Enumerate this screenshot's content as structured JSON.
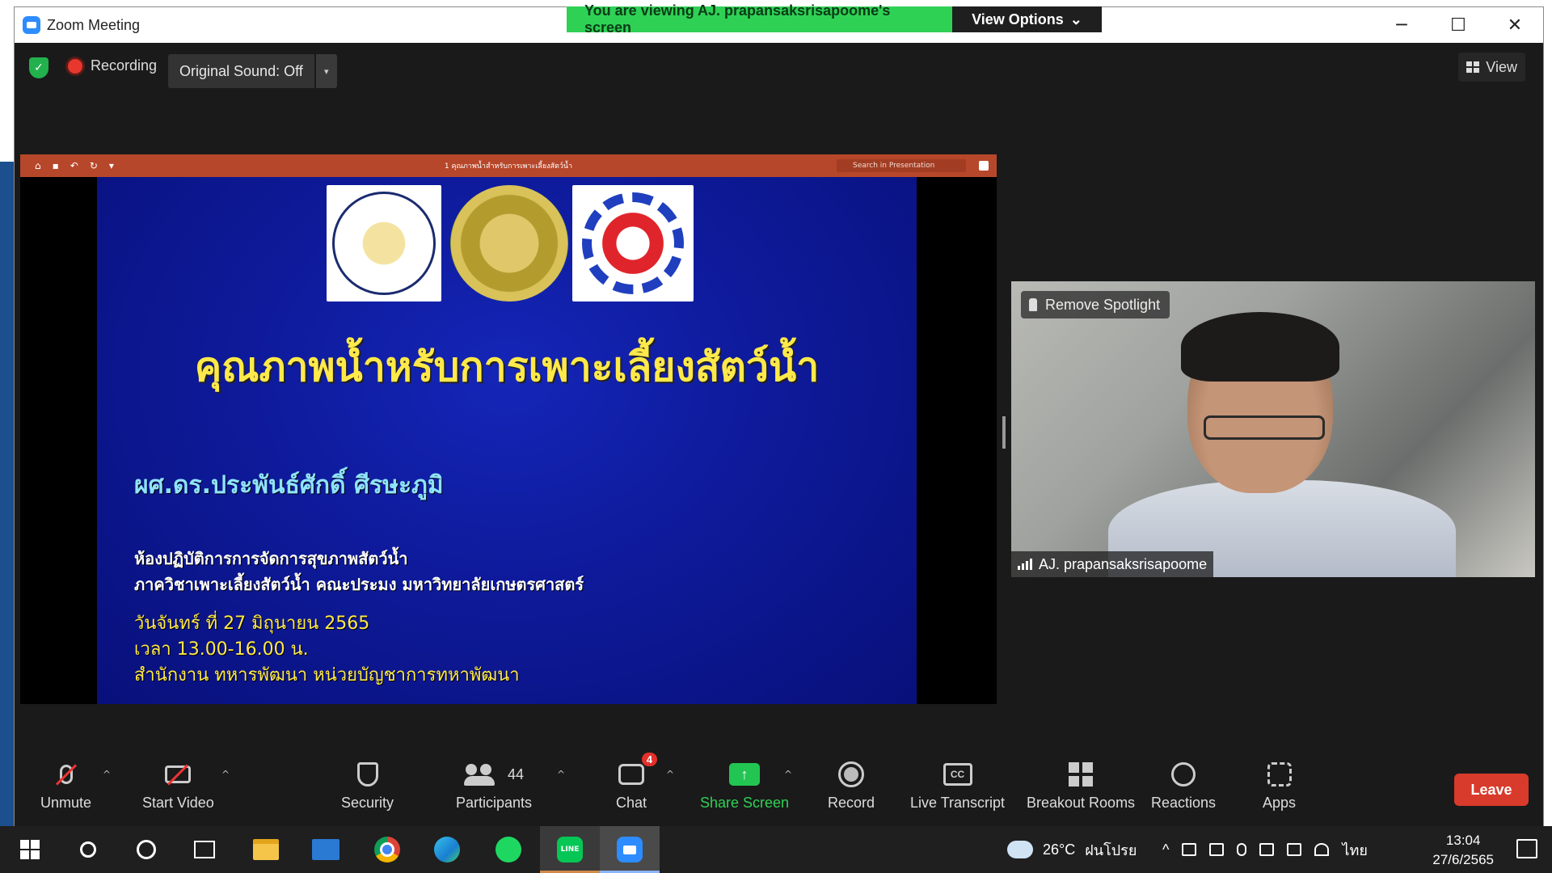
{
  "window": {
    "title": "Zoom Meeting",
    "controls": {
      "minimize": "─",
      "maximize": "☐",
      "close": "✕"
    }
  },
  "banner": {
    "viewing_text": "You are viewing AJ. prapansaksrisapoome's screen",
    "view_options_label": "View Options",
    "view_options_caret": "⌄"
  },
  "topbar": {
    "recording_label": "Recording",
    "original_sound_label": "Original Sound: Off",
    "dropdown_caret": "▾",
    "view_label": "View"
  },
  "shared_app": {
    "document_title": "1 คุณภาพน้ำสำหรับการเพาะเลี้ยงสัตว์น้ำ",
    "search_placeholder": "Search in Presentation",
    "toolbar_icons": [
      "home-icon",
      "save-icon",
      "undo-icon",
      "redo-icon",
      "more-icon"
    ]
  },
  "slide": {
    "title": "คุณภาพน้ำหรับการเพาะเลี้ยงสัตว์น้ำ",
    "author": "ผศ.ดร.ประพันธ์ศักดิ์ ศีรษะภูมิ",
    "lab_line1": "ห้องปฏิบัติการการจัดการสุขภาพสัตว์น้ำ",
    "lab_line2": "ภาควิชาเพาะเลี้ยงสัตว์น้ำ คณะประมง มหาวิทยาลัยเกษตรศาสตร์",
    "date_line": "วันจันทร์ ที่ 27 มิถุนายน 2565",
    "time_line": "เวลา 13.00-16.00 น.",
    "place_line": "สำนักงาน ทหารพัฒนา หน่วยบัญชาการทหาพัฒนา",
    "colors": {
      "title": "#ffe94a",
      "author": "#8fe3ff",
      "background": "#0e1a9a"
    }
  },
  "video": {
    "remove_spotlight_label": "Remove Spotlight",
    "participant_name": "AJ. prapansaksrisapoome"
  },
  "toolbar": {
    "unmute_label": "Unmute",
    "start_video_label": "Start Video",
    "security_label": "Security",
    "participants_label": "Participants",
    "participants_count": "44",
    "chat_label": "Chat",
    "chat_badge": "4",
    "share_screen_label": "Share Screen",
    "record_label": "Record",
    "live_transcript_label": "Live Transcript",
    "cc_text": "CC",
    "breakout_rooms_label": "Breakout Rooms",
    "reactions_label": "Reactions",
    "apps_label": "Apps",
    "leave_label": "Leave",
    "caret": "^",
    "share_arrow": "↑",
    "colors": {
      "share_green": "#23c552",
      "leave_red": "#d83b2b",
      "badge_red": "#e4302b"
    }
  },
  "taskbar": {
    "line_text": "LINE",
    "weather_temp": "26°C",
    "weather_desc": "ฝนโปรย",
    "tray_caret": "^",
    "language": "ไทย",
    "time": "13:04",
    "date": "27/6/2565"
  }
}
